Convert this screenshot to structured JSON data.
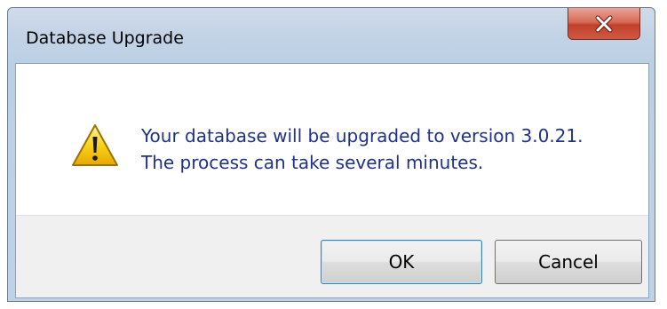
{
  "window": {
    "title": "Database Upgrade"
  },
  "titlebar": {
    "close_icon": "close-icon"
  },
  "message": {
    "icon": "warning-icon",
    "line1": "Your database will be upgraded to version 3.0.21.",
    "line2": "The process can take several minutes."
  },
  "buttons": {
    "ok_label": "OK",
    "cancel_label": "Cancel"
  },
  "colors": {
    "message_text": "#1e3287",
    "close_button": "#c2402b",
    "warning_fill": "#f5c400"
  }
}
